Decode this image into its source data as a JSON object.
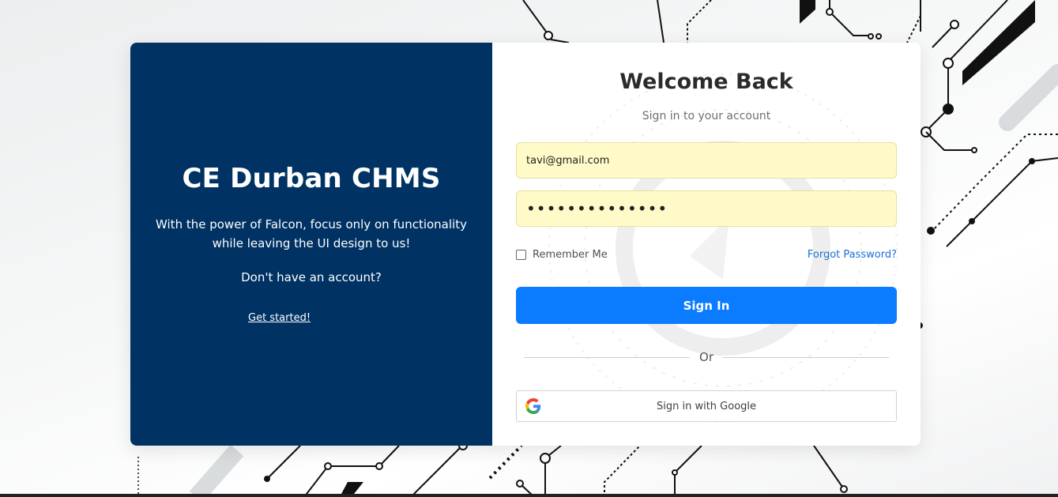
{
  "brand": {
    "title": "CE Durban CHMS",
    "description": "With the power of Falcon, focus only on functionality while leaving the UI design to us!",
    "no_account": "Don't have an account?",
    "get_started": "Get started!"
  },
  "login": {
    "heading": "Welcome Back",
    "subheading": "Sign in to your account",
    "email_value": "tavi@gmail.com",
    "password_value": "••••••••••••••",
    "remember_label": "Remember Me",
    "forgot_label": "Forgot Password?",
    "signin_label": "Sign In",
    "divider_label": "Or",
    "google_label": "Sign in with Google"
  },
  "colors": {
    "panel": "#003263",
    "primary": "#0b7bff",
    "autofill": "#fffac8",
    "link": "#1a6fd6"
  },
  "icons": {
    "google": "google-g-icon",
    "checkbox": "checkbox-unchecked"
  }
}
